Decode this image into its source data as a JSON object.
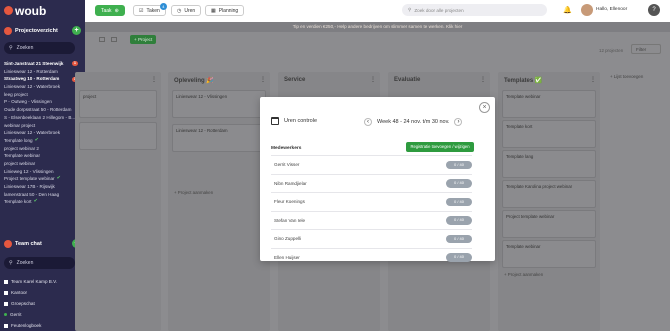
{
  "app": {
    "logo_text": "woub"
  },
  "sidebar": {
    "projects_title": "Projectoverzicht",
    "search_placeholder": "Zoeken",
    "projects": [
      {
        "label": "Sint-Janstraat 21 Steenwijk",
        "bold": true,
        "badge": "1"
      },
      {
        "label": "Linieswear 12 - Rotterdam",
        "bold": false
      },
      {
        "label": "Straatweg 10 - Rotterdam",
        "bold": true,
        "badge": "1"
      },
      {
        "label": "Linieswear 12 - Waterbroek",
        "bold": false
      },
      {
        "label": "leeg project",
        "bold": false
      },
      {
        "label": "P - Outweg - Vlissingen",
        "bold": false
      },
      {
        "label": "Oude dorpsstraat 50 - Rotterdam",
        "bold": false
      },
      {
        "label": "S - Elsenbeeklaan 2 Hillegom - B...",
        "bold": false
      },
      {
        "label": "webinar project",
        "bold": false
      },
      {
        "label": "Linieswear 12 - Waterbroek",
        "bold": false
      },
      {
        "label": "Template long",
        "bold": false,
        "check": true
      },
      {
        "label": "project webinar 2",
        "bold": false
      },
      {
        "label": "Template webinar",
        "bold": false
      },
      {
        "label": "project webinar",
        "bold": false
      },
      {
        "label": "Linieweg 12 - Vlissingen",
        "bold": false
      },
      {
        "label": "Project template webinar",
        "bold": false,
        "check": true
      },
      {
        "label": "Linieswear 17B - Rijswijk",
        "bold": false
      },
      {
        "label": "lamenstraat 50 - Den Haag",
        "bold": false
      },
      {
        "label": "Template kort",
        "bold": false,
        "check": true
      }
    ],
    "chat_title": "Team chat",
    "chat_search_placeholder": "Zoeken",
    "chats": [
      {
        "label": "Team Karel Kamp B.V."
      },
      {
        "label": "Kantoor"
      },
      {
        "label": "Groepschat"
      },
      {
        "label": "Gerrit"
      },
      {
        "label": "Feutenlogboek"
      }
    ]
  },
  "topbar": {
    "task_label": "Taak",
    "tasks_label": "Taken",
    "tasks_badge": "4",
    "hours_label": "Uren",
    "planning_label": "Planning",
    "search_placeholder": "Zoek door alle projecten",
    "greeting": "Hallo, Ellenoor",
    "help": "?"
  },
  "board": {
    "tip": "Tip en verdien €250,- Help andere bedrijven om slimmer samen te werken. Klik hier",
    "new_project": "+ Project",
    "project_count": "12 projecten",
    "filter_label": "Filter",
    "add_column": "+ Lijst toevoegen",
    "columns": [
      {
        "title": "",
        "cards": [
          "",
          "project",
          "",
          ""
        ]
      },
      {
        "title": "Opleveling 🎉",
        "cards": [
          "Linieswear 12 - Vlissingen",
          "Linieswear 12 - Rotterdam"
        ],
        "add": "+ Project aanmaken"
      },
      {
        "title": "Service",
        "cards": []
      },
      {
        "title": "Evaluatie",
        "cards": []
      },
      {
        "title": "Templates ✅",
        "cards": [
          "Template webinar",
          "Template kort",
          "Template lang",
          "Template Karolina project webinar",
          "Project template webinar",
          "Template webinar"
        ],
        "add": "+ Project aanmaken"
      }
    ]
  },
  "modal": {
    "title": "Uren controle",
    "week_label": "Week 48 - 24 nov. t/m 30 nov.",
    "section_label": "Medewerkers",
    "register_button": "Registratie toevoegen / wijzigen",
    "workers": [
      {
        "name": "Gerrit Visser",
        "hours": "0 / 40"
      },
      {
        "name": "Nibn Ramdjielar",
        "hours": "0 / 40"
      },
      {
        "name": "Fleur Koenings",
        "hours": "0 / 40"
      },
      {
        "name": "Stefan Van Iele",
        "hours": "0 / 40"
      },
      {
        "name": "Gino Zuppelli",
        "hours": "0 / 40"
      },
      {
        "name": "Ellen Huijser",
        "hours": "0 / 40"
      }
    ]
  }
}
